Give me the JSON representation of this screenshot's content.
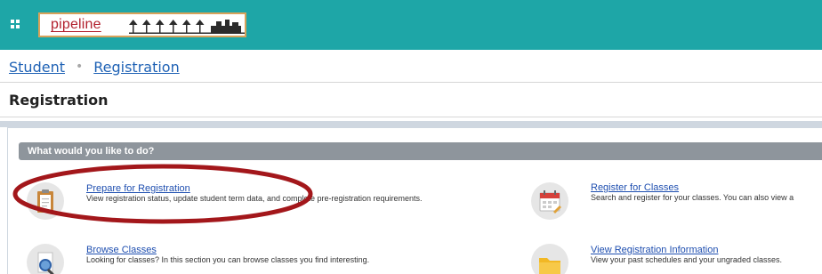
{
  "header": {
    "logo_text": "pipeline",
    "menu_icon": "grid-icon"
  },
  "breadcrumb": {
    "items": [
      "Student",
      "Registration"
    ]
  },
  "page": {
    "title": "Registration"
  },
  "panel": {
    "heading": "What would you like to do?",
    "options": [
      {
        "label": "Prepare for Registration",
        "description": "View registration status, update student term data, and complete pre-registration requirements.",
        "icon": "clipboard-icon"
      },
      {
        "label": "Register for Classes",
        "description": "Search and register for your classes. You can also view a",
        "icon": "calendar-icon"
      },
      {
        "label": "Browse Classes",
        "description": "Looking for classes? In this section you can browse classes you find interesting.",
        "icon": "magnifier-icon"
      },
      {
        "label": "View Registration Information",
        "description": "View your past schedules and your ungraded classes.",
        "icon": "folder-icon"
      }
    ]
  },
  "colors": {
    "header_bg": "#1ea6a7",
    "link": "#1f62b5",
    "annotation": "#a3171b",
    "panel_head": "#8e959c"
  }
}
